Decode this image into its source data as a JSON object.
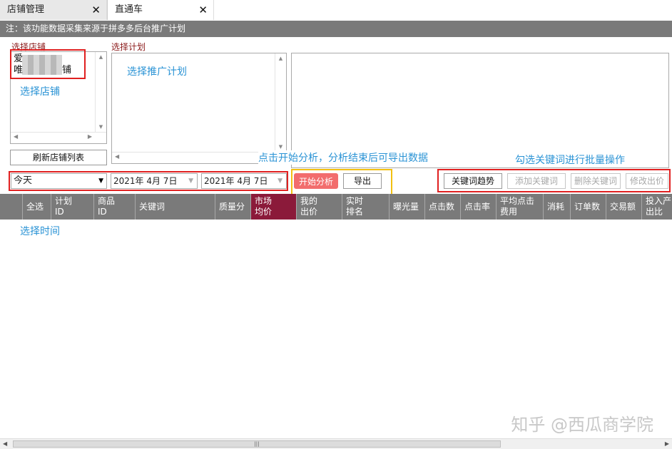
{
  "tabs": [
    {
      "label": "店铺管理",
      "close": "✕"
    },
    {
      "label": "直通车",
      "close": "✕"
    }
  ],
  "notice": "注：该功能数据采集来源于拼多多后台推广计划",
  "shop_panel": {
    "label": "选择店铺",
    "items": [
      "爱",
      "唯",
      "铺"
    ],
    "refresh_button": "刷新店铺列表"
  },
  "plan_panel": {
    "label": "选择计划"
  },
  "filters": {
    "period": "今天",
    "start_date": "2021年  4月  7日",
    "end_date": "2021年  4月  7日"
  },
  "actions": {
    "start": "开始分析",
    "export": "导出",
    "trend": "关键词趋势",
    "add": "添加关键词",
    "delete": "删除关键词",
    "modify": "修改出价"
  },
  "columns": [
    {
      "label": "全选"
    },
    {
      "label": "计划\nID"
    },
    {
      "label": "商品\nID"
    },
    {
      "label": "关键词"
    },
    {
      "label": "质量分"
    },
    {
      "label": "市场\n均价"
    },
    {
      "label": "我的\n出价"
    },
    {
      "label": "实时\n排名"
    },
    {
      "label": "曝光量"
    },
    {
      "label": "点击数"
    },
    {
      "label": "点击率"
    },
    {
      "label": "平均点击\n费用"
    },
    {
      "label": "消耗"
    },
    {
      "label": "订单数"
    },
    {
      "label": "交易额"
    },
    {
      "label": "投入产\n出比"
    }
  ],
  "annotations": {
    "select_shop": "选择店铺",
    "select_plan": "选择推广计划",
    "start_hint": "点击开始分析，分析结束后可导出数据",
    "batch_hint": "勾选关键词进行批量操作",
    "select_time": "选择时间"
  },
  "watermark": "知乎 @西瓜商学院",
  "colors": {
    "annotation": "#2a93d5",
    "highlight_box": "#e02020",
    "export_box": "#f2c012",
    "start_button": "#f26d6d"
  }
}
